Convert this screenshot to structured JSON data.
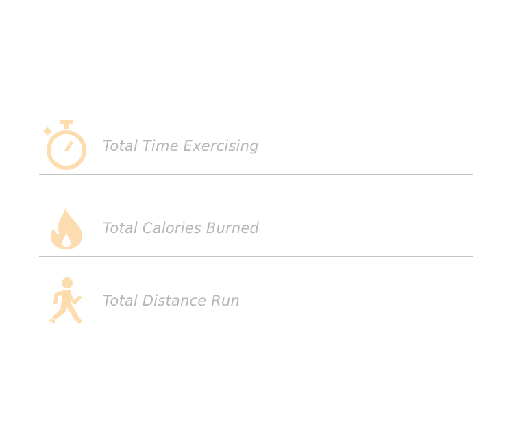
{
  "colors": {
    "icon": "#fddcaf",
    "label": "#b6b6b6",
    "divider": "#c4c4c4",
    "background": "#ffffff"
  },
  "stats": [
    {
      "icon": "stopwatch-icon",
      "label": "Total Time Exercising"
    },
    {
      "icon": "flame-icon",
      "label": "Total Calories Burned"
    },
    {
      "icon": "running-person-icon",
      "label": "Total Distance Run"
    }
  ]
}
